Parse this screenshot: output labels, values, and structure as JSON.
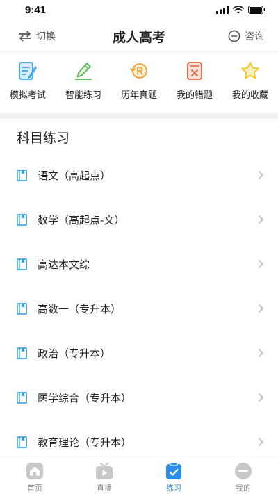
{
  "status_bar": {
    "time": "9:41"
  },
  "nav": {
    "switch_label": "切换",
    "title": "成人高考",
    "consult_label": "咨询"
  },
  "shortcuts": [
    {
      "label": "模拟考试",
      "icon": "mock-exam-icon"
    },
    {
      "label": "智能练习",
      "icon": "pencil-icon"
    },
    {
      "label": "历年真题",
      "icon": "history-exam-icon"
    },
    {
      "label": "我的错题",
      "icon": "wrong-questions-icon"
    },
    {
      "label": "我的收藏",
      "icon": "star-icon"
    }
  ],
  "section": {
    "title": "科目练习"
  },
  "subjects": [
    "语文（高起点）",
    "数学（高起点-文）",
    "高达本文综",
    "高数一（专升本）",
    "政治（专升本）",
    "医学综合（专升本）",
    "教育理论（专升本）"
  ],
  "tabs": [
    {
      "label": "首页",
      "icon": "home-icon"
    },
    {
      "label": "直播",
      "icon": "live-icon"
    },
    {
      "label": "练习",
      "icon": "practice-icon",
      "active": true
    },
    {
      "label": "我的",
      "icon": "profile-icon"
    }
  ],
  "colors": {
    "accent": "#2b8ee8",
    "shortcut_blue": "#3aa0e0",
    "green": "#5cb85c",
    "orange": "#f0a030",
    "red": "#e06040",
    "star": "#f5c518"
  }
}
